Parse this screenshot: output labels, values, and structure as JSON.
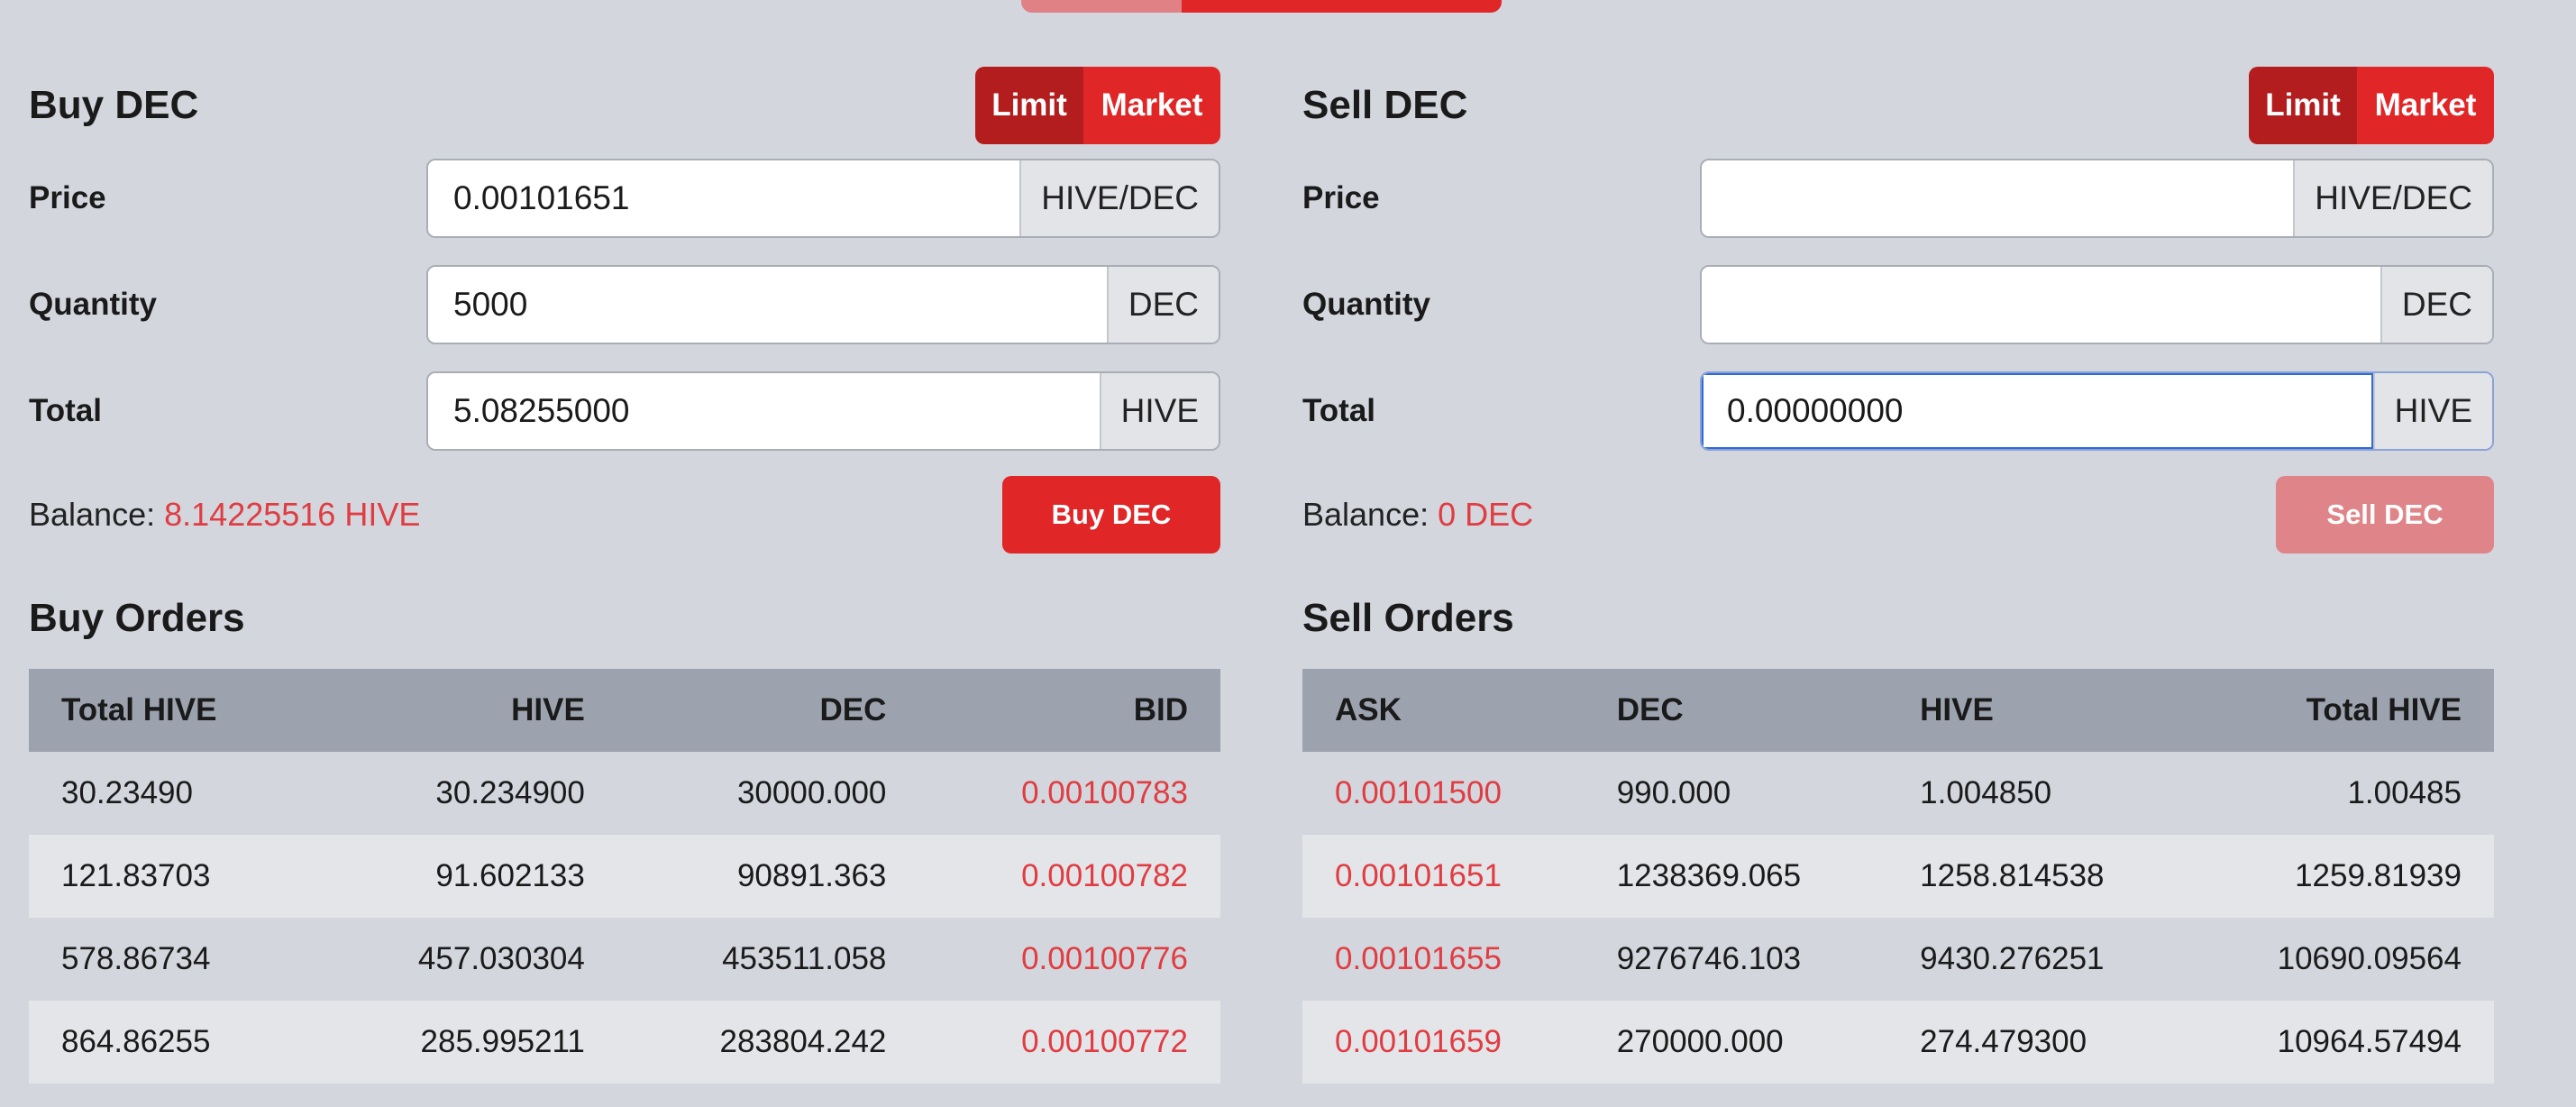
{
  "colors": {
    "accent": "#e02627",
    "accent_dark": "#b31d1e",
    "price_red": "#e03c41",
    "background": "#d3d6dd"
  },
  "buy": {
    "title": "Buy DEC",
    "mode_limit": "Limit",
    "mode_market": "Market",
    "price_label": "Price",
    "price_value": "0.00101651",
    "price_unit": "HIVE/DEC",
    "quantity_label": "Quantity",
    "quantity_value": "5000",
    "quantity_unit": "DEC",
    "total_label": "Total",
    "total_value": "5.08255000",
    "total_unit": "HIVE",
    "balance_label": "Balance:",
    "balance_value": "8.14225516 HIVE",
    "action_label": "Buy DEC"
  },
  "sell": {
    "title": "Sell DEC",
    "mode_limit": "Limit",
    "mode_market": "Market",
    "price_label": "Price",
    "price_value": "",
    "price_unit": "HIVE/DEC",
    "quantity_label": "Quantity",
    "quantity_value": "",
    "quantity_unit": "DEC",
    "total_label": "Total",
    "total_value": "0.00000000",
    "total_unit": "HIVE",
    "balance_label": "Balance:",
    "balance_value": "0 DEC",
    "action_label": "Sell DEC"
  },
  "buy_orders": {
    "title": "Buy Orders",
    "headers": [
      "Total HIVE",
      "HIVE",
      "DEC",
      "BID"
    ],
    "rows": [
      [
        "30.23490",
        "30.234900",
        "30000.000",
        "0.00100783"
      ],
      [
        "121.83703",
        "91.602133",
        "90891.363",
        "0.00100782"
      ],
      [
        "578.86734",
        "457.030304",
        "453511.058",
        "0.00100776"
      ],
      [
        "864.86255",
        "285.995211",
        "283804.242",
        "0.00100772"
      ]
    ]
  },
  "sell_orders": {
    "title": "Sell Orders",
    "headers": [
      "ASK",
      "DEC",
      "HIVE",
      "Total HIVE"
    ],
    "rows": [
      [
        "0.00101500",
        "990.000",
        "1.004850",
        "1.00485"
      ],
      [
        "0.00101651",
        "1238369.065",
        "1258.814538",
        "1259.81939"
      ],
      [
        "0.00101655",
        "9276746.103",
        "9430.276251",
        "10690.09564"
      ],
      [
        "0.00101659",
        "270000.000",
        "274.479300",
        "10964.57494"
      ]
    ]
  }
}
